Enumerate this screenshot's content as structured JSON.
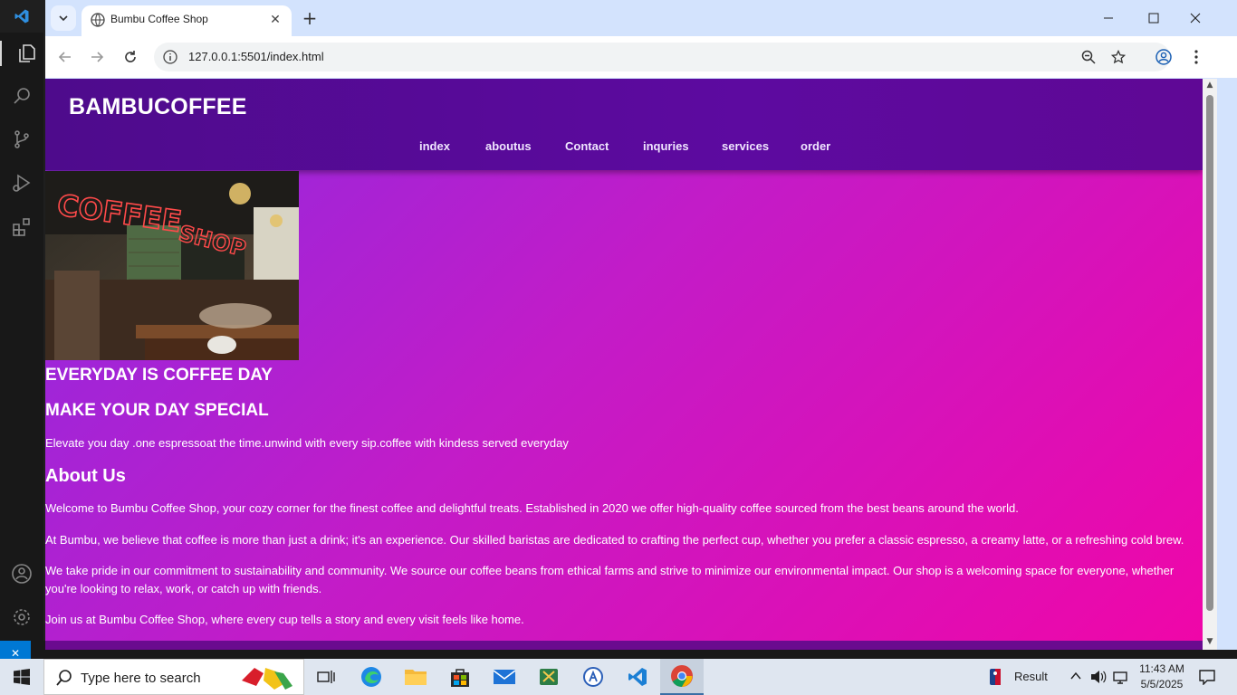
{
  "browser": {
    "tab_title": "Bumbu Coffee Shop",
    "url": "127.0.0.1:5501/index.html"
  },
  "site": {
    "brand": "BAMBUCOFFEE",
    "nav": [
      "index",
      "aboutus",
      "Contact",
      "inquries",
      "services",
      "order"
    ],
    "hero_image_alt": "COFFEE SHOP",
    "headline1": "EVERYDAY IS COFFEE DAY",
    "headline2": "MAKE YOUR DAY SPECIAL",
    "tagline": "Elevate you day .one espressoat the time.unwind with every sip.coffee with kindess served everyday",
    "about_heading": "About Us",
    "about_paragraphs": [
      "Welcome to Bumbu Coffee Shop, your cozy corner for the finest coffee and delightful treats. Established in 2020 we offer high-quality coffee sourced from the best beans around the world.",
      "At Bumbu, we believe that coffee is more than just a drink; it's an experience. Our skilled baristas are dedicated to crafting the perfect cup, whether you prefer a classic espresso, a creamy latte, or a refreshing cold brew.",
      "We take pride in our commitment to sustainability and community. We source our coffee beans from ethical farms and strive to minimize our environmental impact. Our shop is a welcoming space for everyone, whether you're looking to relax, work, or catch up with friends.",
      "Join us at Bumbu Coffee Shop, where every cup tells a story and every visit feels like home."
    ]
  },
  "taskbar": {
    "search_placeholder": "Type here to search",
    "tray_result": "Result",
    "time": "11:43 AM",
    "date": "5/5/2025"
  },
  "colors": {
    "header_purple": "#5a0a9a",
    "gradient_start": "#8a2be2",
    "gradient_end": "#f006a8"
  }
}
